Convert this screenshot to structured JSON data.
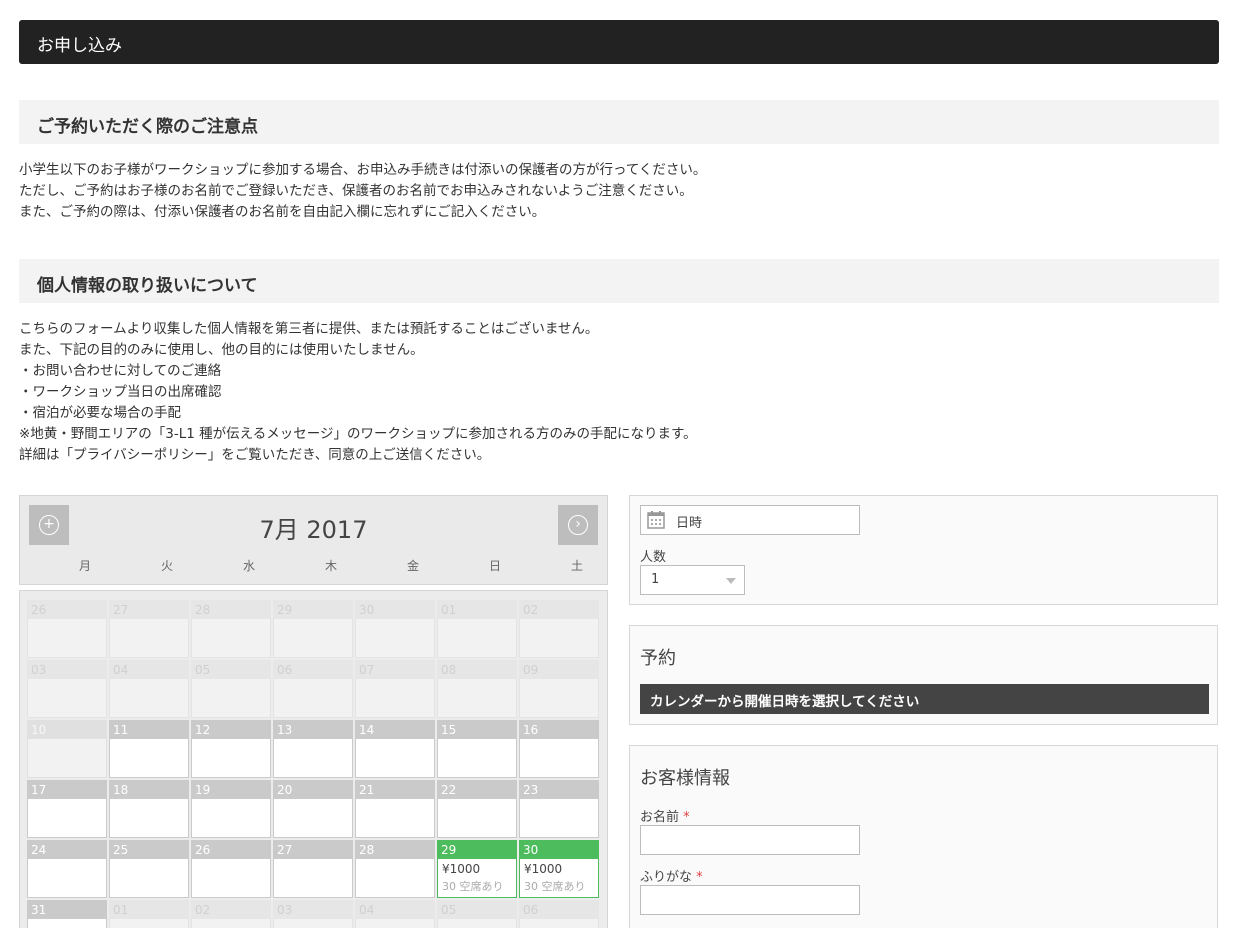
{
  "header": {
    "title": "お申し込み"
  },
  "notice": {
    "heading": "ご予約いただく際のご注意点",
    "lines": [
      "小学生以下のお子様がワークショップに参加する場合、お申込み手続きは付添いの保護者の方が行ってください。",
      "ただし、ご予約はお子様のお名前でご登録いただき、保護者のお名前でお申込みされないようご注意ください。",
      "また、ご予約の際は、付添い保護者のお名前を自由記入欄に忘れずにご記入ください。"
    ]
  },
  "privacy": {
    "heading": "個人情報の取り扱いについて",
    "lines": [
      "こちらのフォームより収集した個人情報を第三者に提供、または預託することはございません。",
      "また、下記の目的のみに使用し、他の目的には使用いたしません。",
      "・お問い合わせに対してのご連絡",
      "・ワークショップ当日の出席確認",
      "・宿泊が必要な場合の手配",
      "※地黄・野間エリアの「3-L1 種が伝えるメッセージ」のワークショップに参加される方のみの手配になります。",
      "詳細は「プライバシーポリシー」をご覧いただき、同意の上ご送信ください。"
    ]
  },
  "calendar": {
    "title": "7月 2017",
    "prev_icon": "plus-circle-icon",
    "next_icon": "chevron-right-circle-icon",
    "weekdays": [
      "月",
      "火",
      "水",
      "木",
      "金",
      "日",
      "土"
    ],
    "weeks": [
      [
        {
          "d": "26",
          "s": "out"
        },
        {
          "d": "27",
          "s": "out"
        },
        {
          "d": "28",
          "s": "out"
        },
        {
          "d": "29",
          "s": "out"
        },
        {
          "d": "30",
          "s": "out"
        },
        {
          "d": "01",
          "s": "out"
        },
        {
          "d": "02",
          "s": "out"
        }
      ],
      [
        {
          "d": "03",
          "s": "out"
        },
        {
          "d": "04",
          "s": "out"
        },
        {
          "d": "05",
          "s": "out"
        },
        {
          "d": "06",
          "s": "out"
        },
        {
          "d": "07",
          "s": "out"
        },
        {
          "d": "08",
          "s": "out"
        },
        {
          "d": "09",
          "s": "out"
        }
      ],
      [
        {
          "d": "10",
          "s": "past"
        },
        {
          "d": "11",
          "s": "cur"
        },
        {
          "d": "12",
          "s": "cur"
        },
        {
          "d": "13",
          "s": "cur"
        },
        {
          "d": "14",
          "s": "cur"
        },
        {
          "d": "15",
          "s": "cur"
        },
        {
          "d": "16",
          "s": "cur"
        }
      ],
      [
        {
          "d": "17",
          "s": "cur"
        },
        {
          "d": "18",
          "s": "cur"
        },
        {
          "d": "19",
          "s": "cur"
        },
        {
          "d": "20",
          "s": "cur"
        },
        {
          "d": "21",
          "s": "cur"
        },
        {
          "d": "22",
          "s": "cur"
        },
        {
          "d": "23",
          "s": "cur"
        }
      ],
      [
        {
          "d": "24",
          "s": "cur"
        },
        {
          "d": "25",
          "s": "cur"
        },
        {
          "d": "26",
          "s": "cur"
        },
        {
          "d": "27",
          "s": "cur"
        },
        {
          "d": "28",
          "s": "cur"
        },
        {
          "d": "29",
          "s": "open",
          "price": "¥1000",
          "seats": "30 空席あり"
        },
        {
          "d": "30",
          "s": "open",
          "price": "¥1000",
          "seats": "30 空席あり"
        }
      ],
      [
        {
          "d": "31",
          "s": "cur"
        },
        {
          "d": "01",
          "s": "out"
        },
        {
          "d": "02",
          "s": "out"
        },
        {
          "d": "03",
          "s": "out"
        },
        {
          "d": "04",
          "s": "out"
        },
        {
          "d": "05",
          "s": "out"
        },
        {
          "d": "06",
          "s": "out"
        }
      ]
    ]
  },
  "booking": {
    "date_icon": "calendar-icon",
    "date_placeholder": "日時",
    "people_label": "人数",
    "people_value": "1",
    "reserve_title": "予約",
    "reserve_message": "カレンダーから開催日時を選択してください"
  },
  "customer": {
    "title": "お客様情報",
    "name_label": "お名前",
    "furigana_label": "ふりがな",
    "required_mark": "*"
  },
  "colors": {
    "available": "#4cbc5c",
    "header": "#222222"
  }
}
